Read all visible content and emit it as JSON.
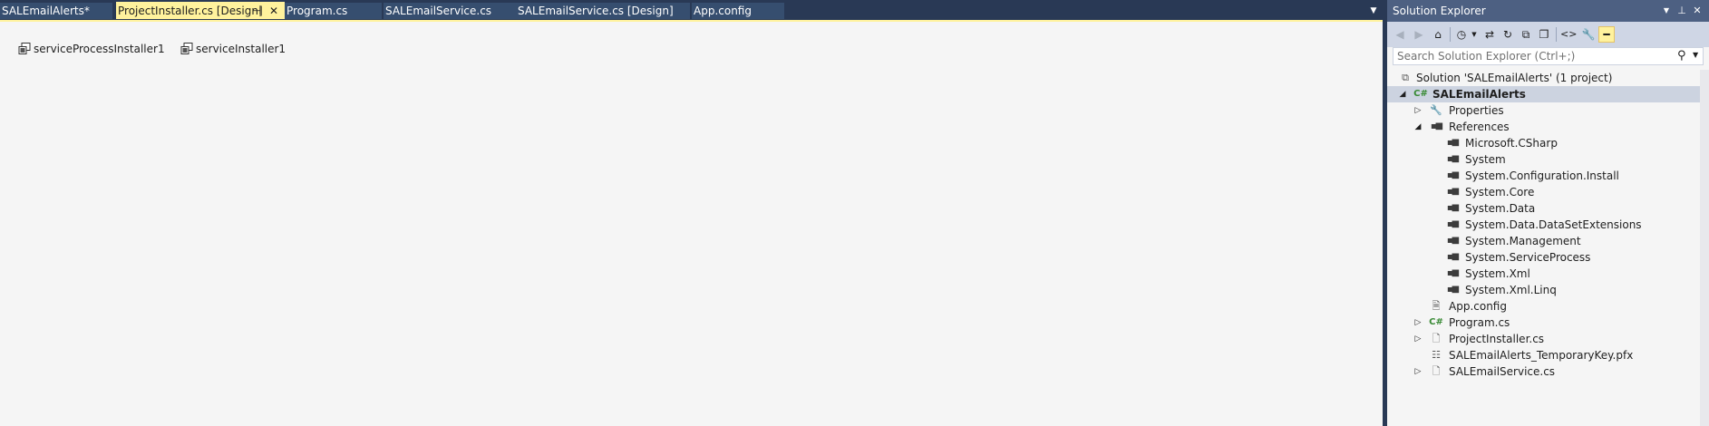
{
  "tabs": [
    {
      "label": "SALEmailAlerts*",
      "active": false
    },
    {
      "label": "ProjectInstaller.cs [Design]",
      "active": true,
      "pinned_icon": "pin-icon",
      "close_icon": "close-icon"
    },
    {
      "label": "Program.cs",
      "active": false
    },
    {
      "label": "SALEmailService.cs",
      "active": false
    },
    {
      "label": "SALEmailService.cs [Design]",
      "active": false
    },
    {
      "label": "App.config",
      "active": false
    }
  ],
  "designer": {
    "components": [
      {
        "label": "serviceProcessInstaller1",
        "icon": "component-icon"
      },
      {
        "label": "serviceInstaller1",
        "icon": "component-icon"
      }
    ]
  },
  "solution_explorer": {
    "title": "Solution Explorer",
    "search_placeholder": "Search Solution Explorer (Ctrl+;)",
    "toolbar": [
      "back-icon",
      "forward-icon",
      "home-icon",
      "pending-changes-icon",
      "sync-icon",
      "refresh-icon",
      "collapse-all-icon",
      "show-all-files-icon",
      "view-code-icon",
      "properties-icon",
      "preview-icon"
    ],
    "tree": [
      {
        "label": "Solution 'SALEmailAlerts' (1 project)",
        "icon": "solution-icon",
        "level": 0,
        "expander": "",
        "selected": false
      },
      {
        "label": "SALEmailAlerts",
        "icon": "csharp-project-icon",
        "level": 0,
        "expander": "expanded",
        "selected": true
      },
      {
        "label": "Properties",
        "icon": "wrench-icon",
        "level": 1,
        "expander": "collapsed",
        "selected": false
      },
      {
        "label": "References",
        "icon": "references-icon",
        "level": 1,
        "expander": "expanded",
        "selected": false
      },
      {
        "label": "Microsoft.CSharp",
        "icon": "reference-icon",
        "level": 2,
        "expander": "",
        "selected": false
      },
      {
        "label": "System",
        "icon": "reference-icon",
        "level": 2,
        "expander": "",
        "selected": false
      },
      {
        "label": "System.Configuration.Install",
        "icon": "reference-icon",
        "level": 2,
        "expander": "",
        "selected": false
      },
      {
        "label": "System.Core",
        "icon": "reference-icon",
        "level": 2,
        "expander": "",
        "selected": false
      },
      {
        "label": "System.Data",
        "icon": "reference-icon",
        "level": 2,
        "expander": "",
        "selected": false
      },
      {
        "label": "System.Data.DataSetExtensions",
        "icon": "reference-icon",
        "level": 2,
        "expander": "",
        "selected": false
      },
      {
        "label": "System.Management",
        "icon": "reference-icon",
        "level": 2,
        "expander": "",
        "selected": false
      },
      {
        "label": "System.ServiceProcess",
        "icon": "reference-icon",
        "level": 2,
        "expander": "",
        "selected": false
      },
      {
        "label": "System.Xml",
        "icon": "reference-icon",
        "level": 2,
        "expander": "",
        "selected": false
      },
      {
        "label": "System.Xml.Linq",
        "icon": "reference-icon",
        "level": 2,
        "expander": "",
        "selected": false
      },
      {
        "label": "App.config",
        "icon": "config-file-icon",
        "level": 1,
        "expander": "",
        "selected": false
      },
      {
        "label": "Program.cs",
        "icon": "csharp-file-icon",
        "level": 1,
        "expander": "collapsed",
        "selected": false
      },
      {
        "label": "ProjectInstaller.cs",
        "icon": "file-icon",
        "level": 1,
        "expander": "collapsed",
        "selected": false
      },
      {
        "label": "SALEmailAlerts_TemporaryKey.pfx",
        "icon": "certificate-icon",
        "level": 1,
        "expander": "",
        "selected": false
      },
      {
        "label": "SALEmailService.cs",
        "icon": "file-icon",
        "level": 1,
        "expander": "collapsed",
        "selected": false
      }
    ]
  }
}
